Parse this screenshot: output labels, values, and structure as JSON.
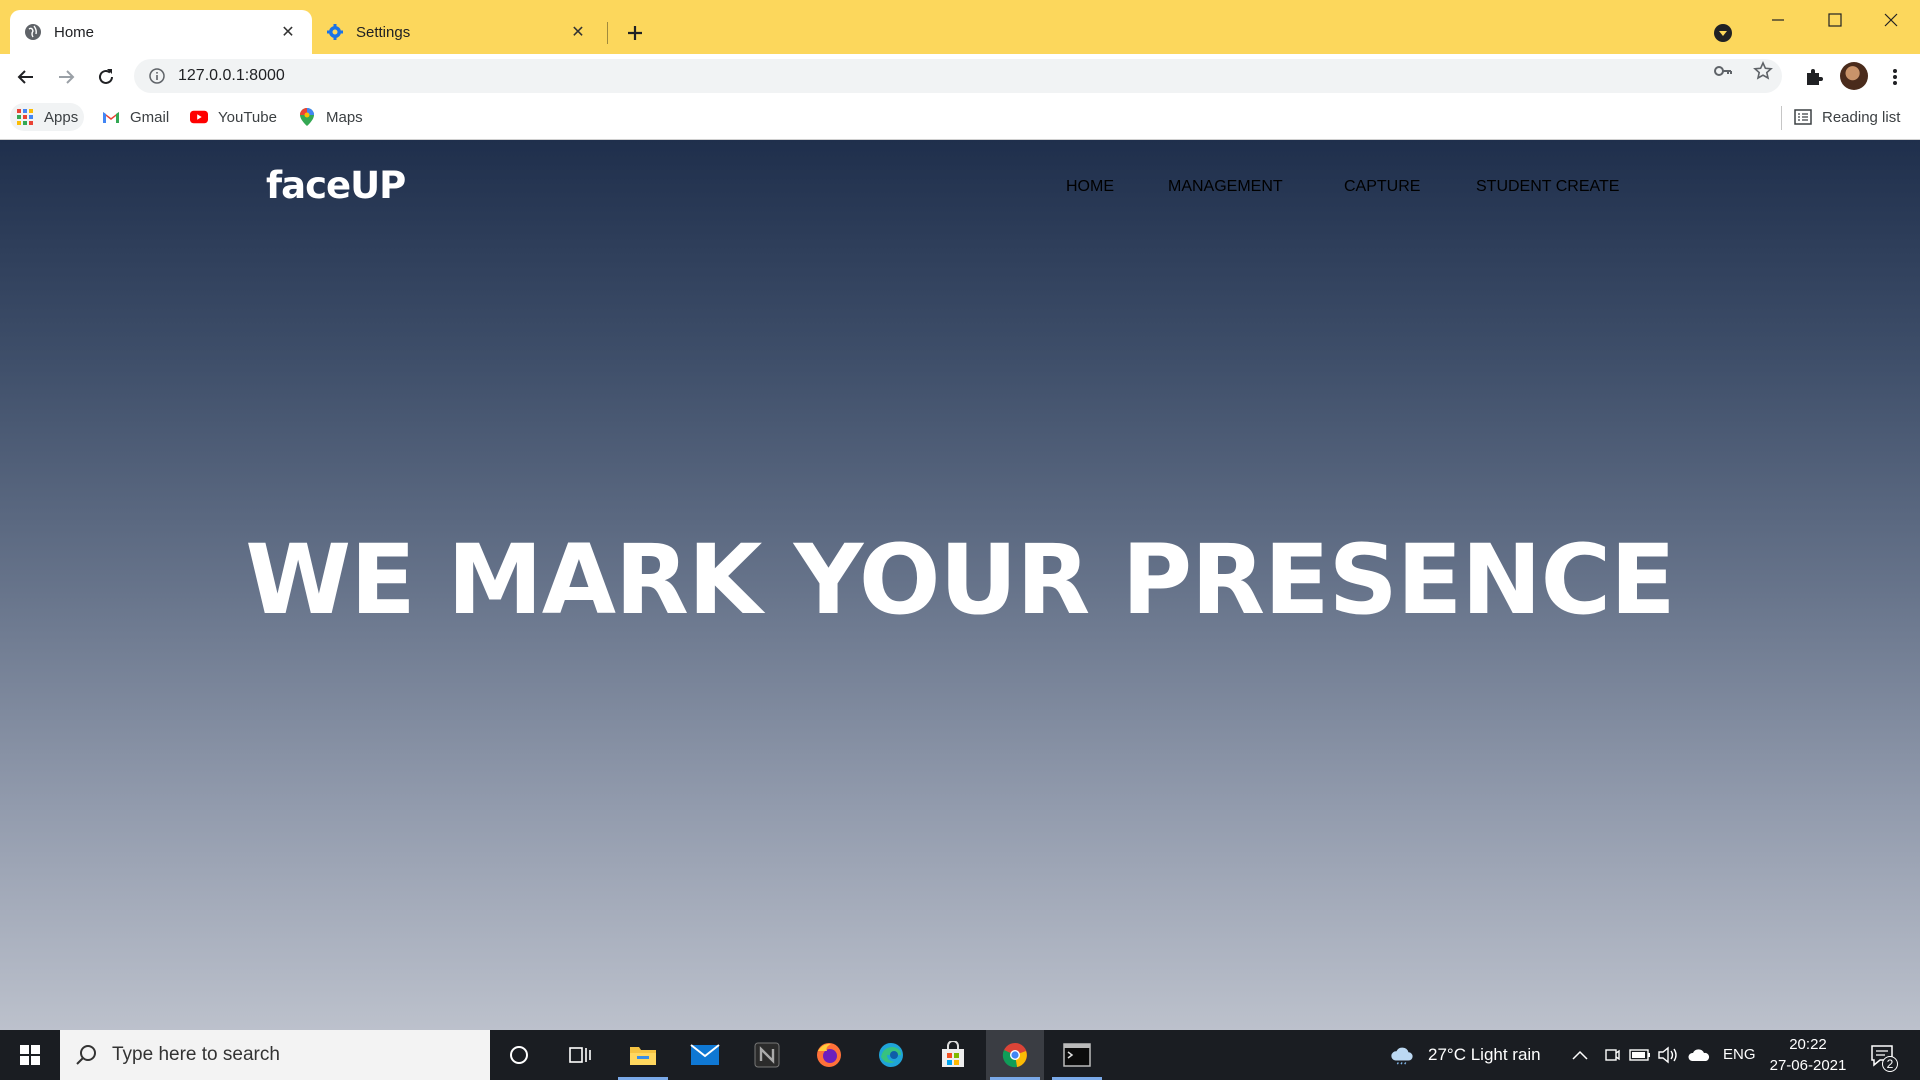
{
  "browser": {
    "tabs": [
      {
        "label": "Home",
        "icon": "globe-icon",
        "active": true
      },
      {
        "label": "Settings",
        "icon": "gear-icon",
        "active": false
      }
    ],
    "address": "127.0.0.1:8000",
    "bookmarks": [
      {
        "label": "Apps",
        "icon": "apps-grid-icon"
      },
      {
        "label": "Gmail",
        "icon": "gmail-icon"
      },
      {
        "label": "YouTube",
        "icon": "youtube-icon"
      },
      {
        "label": "Maps",
        "icon": "maps-pin-icon"
      }
    ],
    "reading_list": "Reading list",
    "accent_color": "#fcd75c"
  },
  "site": {
    "logo": "faceUP",
    "nav": [
      "HOME",
      "MANAGEMENT",
      "CAPTURE",
      "STUDENT CREATE"
    ],
    "headline": "WE MARK YOUR PRESENCE",
    "gradient_top": "#1f2f4c",
    "gradient_bottom": "#bcc1cc"
  },
  "taskbar": {
    "search_placeholder": "Type here to search",
    "weather": "27°C  Light rain",
    "language": "ENG",
    "time": "20:22",
    "date": "27-06-2021",
    "notifications": "2"
  }
}
